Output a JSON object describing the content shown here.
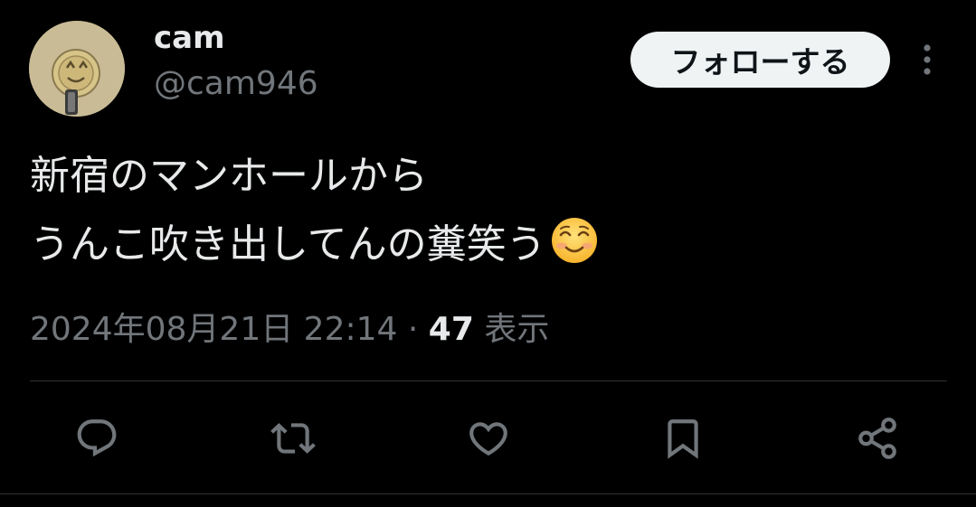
{
  "user": {
    "display_name": "cam",
    "handle": "@cam946"
  },
  "follow_label": "フォローする",
  "tweet": {
    "text_lines": [
      "新宿のマンホールから",
      "うんこ吹き出してんの糞笑う"
    ],
    "emoji": "smiling-face-with-smiling-eyes"
  },
  "meta": {
    "timestamp": "2024年08月21日 22:14",
    "separator": "·",
    "views_count": "47",
    "views_label": "表示"
  },
  "actions": [
    "reply-icon",
    "retweet-icon",
    "like-icon",
    "bookmark-icon",
    "share-icon"
  ],
  "colors": {
    "background": "#000000",
    "text": "#e7e9ea",
    "muted": "#71767b",
    "divider": "#2f3336",
    "follow_bg": "#eff3f4"
  }
}
